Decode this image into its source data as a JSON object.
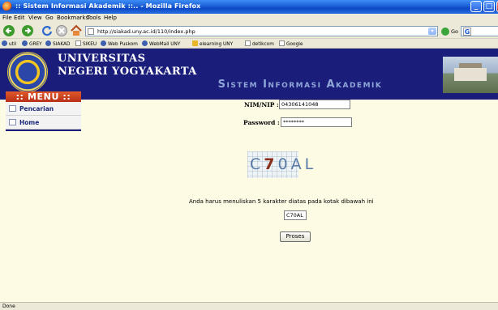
{
  "window": {
    "title": ":: Sistem Informasi Akademik ::.. - Mozilla Firefox"
  },
  "menubar": [
    "File",
    "Edit",
    "View",
    "Go",
    "Bookmarks",
    "Tools",
    "Help"
  ],
  "navbar": {
    "url": "http://siakad.uny.ac.id/110/index.php",
    "go_label": "Go",
    "search_engine": "G"
  },
  "bookmarks": [
    {
      "label": "util",
      "icon": "globe-icon"
    },
    {
      "label": "GREY",
      "icon": "globe-icon"
    },
    {
      "label": "SIAKAD",
      "icon": "globe-icon"
    },
    {
      "label": "SIKEU",
      "icon": "page-icon"
    },
    {
      "label": "Web Puskom",
      "icon": "globe-icon"
    },
    {
      "label": "WebMail UNY",
      "icon": "globe-icon"
    },
    {
      "label": "elearning UNY",
      "icon": "elearning-icon"
    },
    {
      "label": "detikcom",
      "icon": "page-icon"
    },
    {
      "label": "Google",
      "icon": "google-icon"
    }
  ],
  "banner": {
    "line1": "UNIVERSITAS",
    "line2": "NEGERI YOGYAKARTA"
  },
  "sidebar": {
    "title": ":: MENU ::",
    "items": [
      {
        "label": "Pencarian",
        "icon": "page-icon"
      },
      {
        "label": "Home",
        "icon": "page-icon"
      }
    ]
  },
  "form": {
    "system_name": "Sistem Informasi Akademik",
    "nim_label": "NIM/NIP :",
    "nim_value": "04306141048",
    "password_label": "Password :",
    "password_value": "********",
    "captcha_text": [
      "C",
      "7",
      "0",
      "A",
      "L"
    ],
    "instruction": "Anda harus menuliskan 5 karakter diatas pada kotak dibawah ini",
    "captcha_input": "C70AL",
    "submit_label": "Proses"
  },
  "status": {
    "text": "Done"
  },
  "colors": {
    "titlebar": "#0a46c4",
    "banner": "#1a1d7a",
    "menu_title": "#c8401f",
    "page_bg": "#fdfbe4",
    "system_name": "#8ea6d8"
  }
}
